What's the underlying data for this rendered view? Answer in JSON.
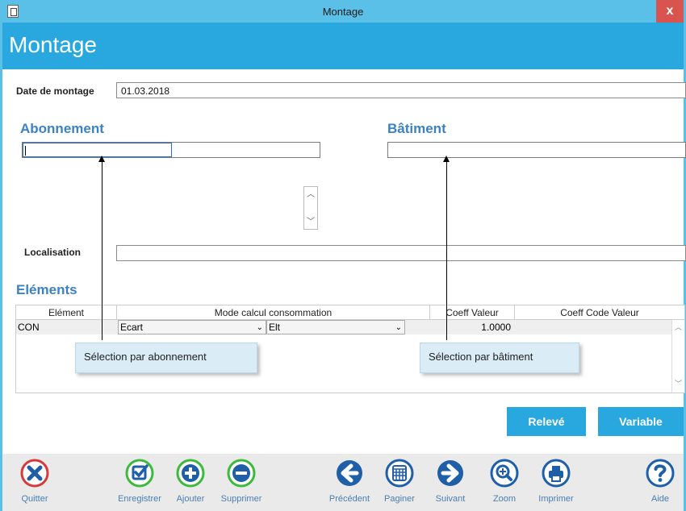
{
  "window": {
    "title": "Montage",
    "close_glyph": "x"
  },
  "header": {
    "title": "Montage"
  },
  "form": {
    "date_label": "Date de montage",
    "date_value": "01.03.2018",
    "abonnement_title": "Abonnement",
    "batiment_title": "Bâtiment",
    "localisation_label": "Localisation",
    "elements_title": "Eléments"
  },
  "grid": {
    "columns": [
      "Elément",
      "Mode calcul consommation",
      "Coeff Valeur",
      "Coeff Code Valeur"
    ],
    "rows": [
      {
        "element": "CON",
        "mode": "Ecart",
        "elt": "Elt",
        "coeff_valeur": "1.0000",
        "coeff_code": ""
      }
    ]
  },
  "annotations": {
    "abonnement": "Sélection par abonnement",
    "batiment": "Sélection par bâtiment"
  },
  "buttons": {
    "releve": "Relevé",
    "variable": "Variable"
  },
  "toolbar": {
    "quitter": "Quitter",
    "enregistrer": "Enregistrer",
    "ajouter": "Ajouter",
    "supprimer": "Supprimer",
    "precedent": "Précédent",
    "paginer": "Paginer",
    "suivant": "Suivant",
    "zoom": "Zoom",
    "imprimer": "Imprimer",
    "aide": "Aide"
  },
  "colors": {
    "titlebar": "#5bc0e8",
    "header": "#29a8e0",
    "section_title": "#3b82c4",
    "toolbar_icon_blue": "#1f5fa8",
    "toolbar_icon_green": "#3cba3c",
    "quit_red": "#d9393b"
  }
}
